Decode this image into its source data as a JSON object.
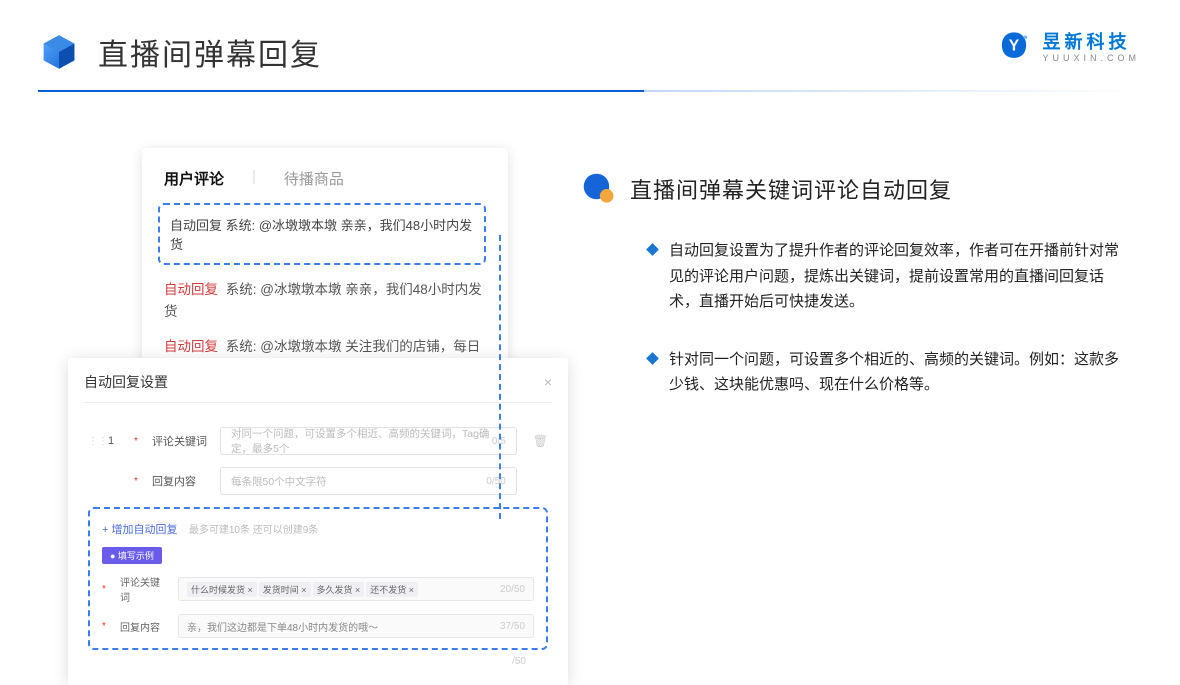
{
  "header": {
    "title": "直播间弹幕回复"
  },
  "brand": {
    "cn": "昱新科技",
    "en": "YUUXIN.COM"
  },
  "comments": {
    "tab_active": "用户评论",
    "tab_inactive": "待播商品",
    "row1_tag": "自动回复",
    "row1_text": "系统: @冰墩墩本墩 亲亲，我们48小时内发货",
    "row2_tag": "自动回复",
    "row2_text": "系统: @冰墩墩本墩 亲亲，我们48小时内发货",
    "row3_tag": "自动回复",
    "row3_text": "系统: @冰墩墩本墩 关注我们的店铺，每日都有热门推荐呦～"
  },
  "settings": {
    "title": "自动回复设置",
    "close": "×",
    "seq": "1",
    "kw_label": "评论关键词",
    "kw_placeholder": "对同一个问题，可设置多个相近、高频的关键词，Tag确定，最多5个",
    "kw_count": "0/5",
    "reply_label": "回复内容",
    "reply_placeholder": "每条限50个中文字符",
    "reply_count": "0/50",
    "add_link": "+ 增加自动回复",
    "add_hint": "最多可建10条 还可以创建9条",
    "example_chip": "● 填写示例",
    "ex_kw_label": "评论关键词",
    "ex_kw_tags": [
      "什么时候发货 ×",
      "发货时间 ×",
      "多久发货 ×",
      "还不发货 ×"
    ],
    "ex_kw_count": "20/50",
    "ex_reply_label": "回复内容",
    "ex_reply_text": "亲，我们这边都是下单48小时内发货的哦～",
    "ex_reply_count": "37/50",
    "bottom_count": "/50"
  },
  "right": {
    "title": "直播间弹幕关键词评论自动回复",
    "bullet1": "自动回复设置为了提升作者的评论回复效率，作者可在开播前针对常见的评论用户问题，提炼出关键词，提前设置常用的直播间回复话术，直播开始后可快捷发送。",
    "bullet2": "针对同一个问题，可设置多个相近的、高频的关键词。例如：这款多少钱、这块能优惠吗、现在什么价格等。"
  }
}
